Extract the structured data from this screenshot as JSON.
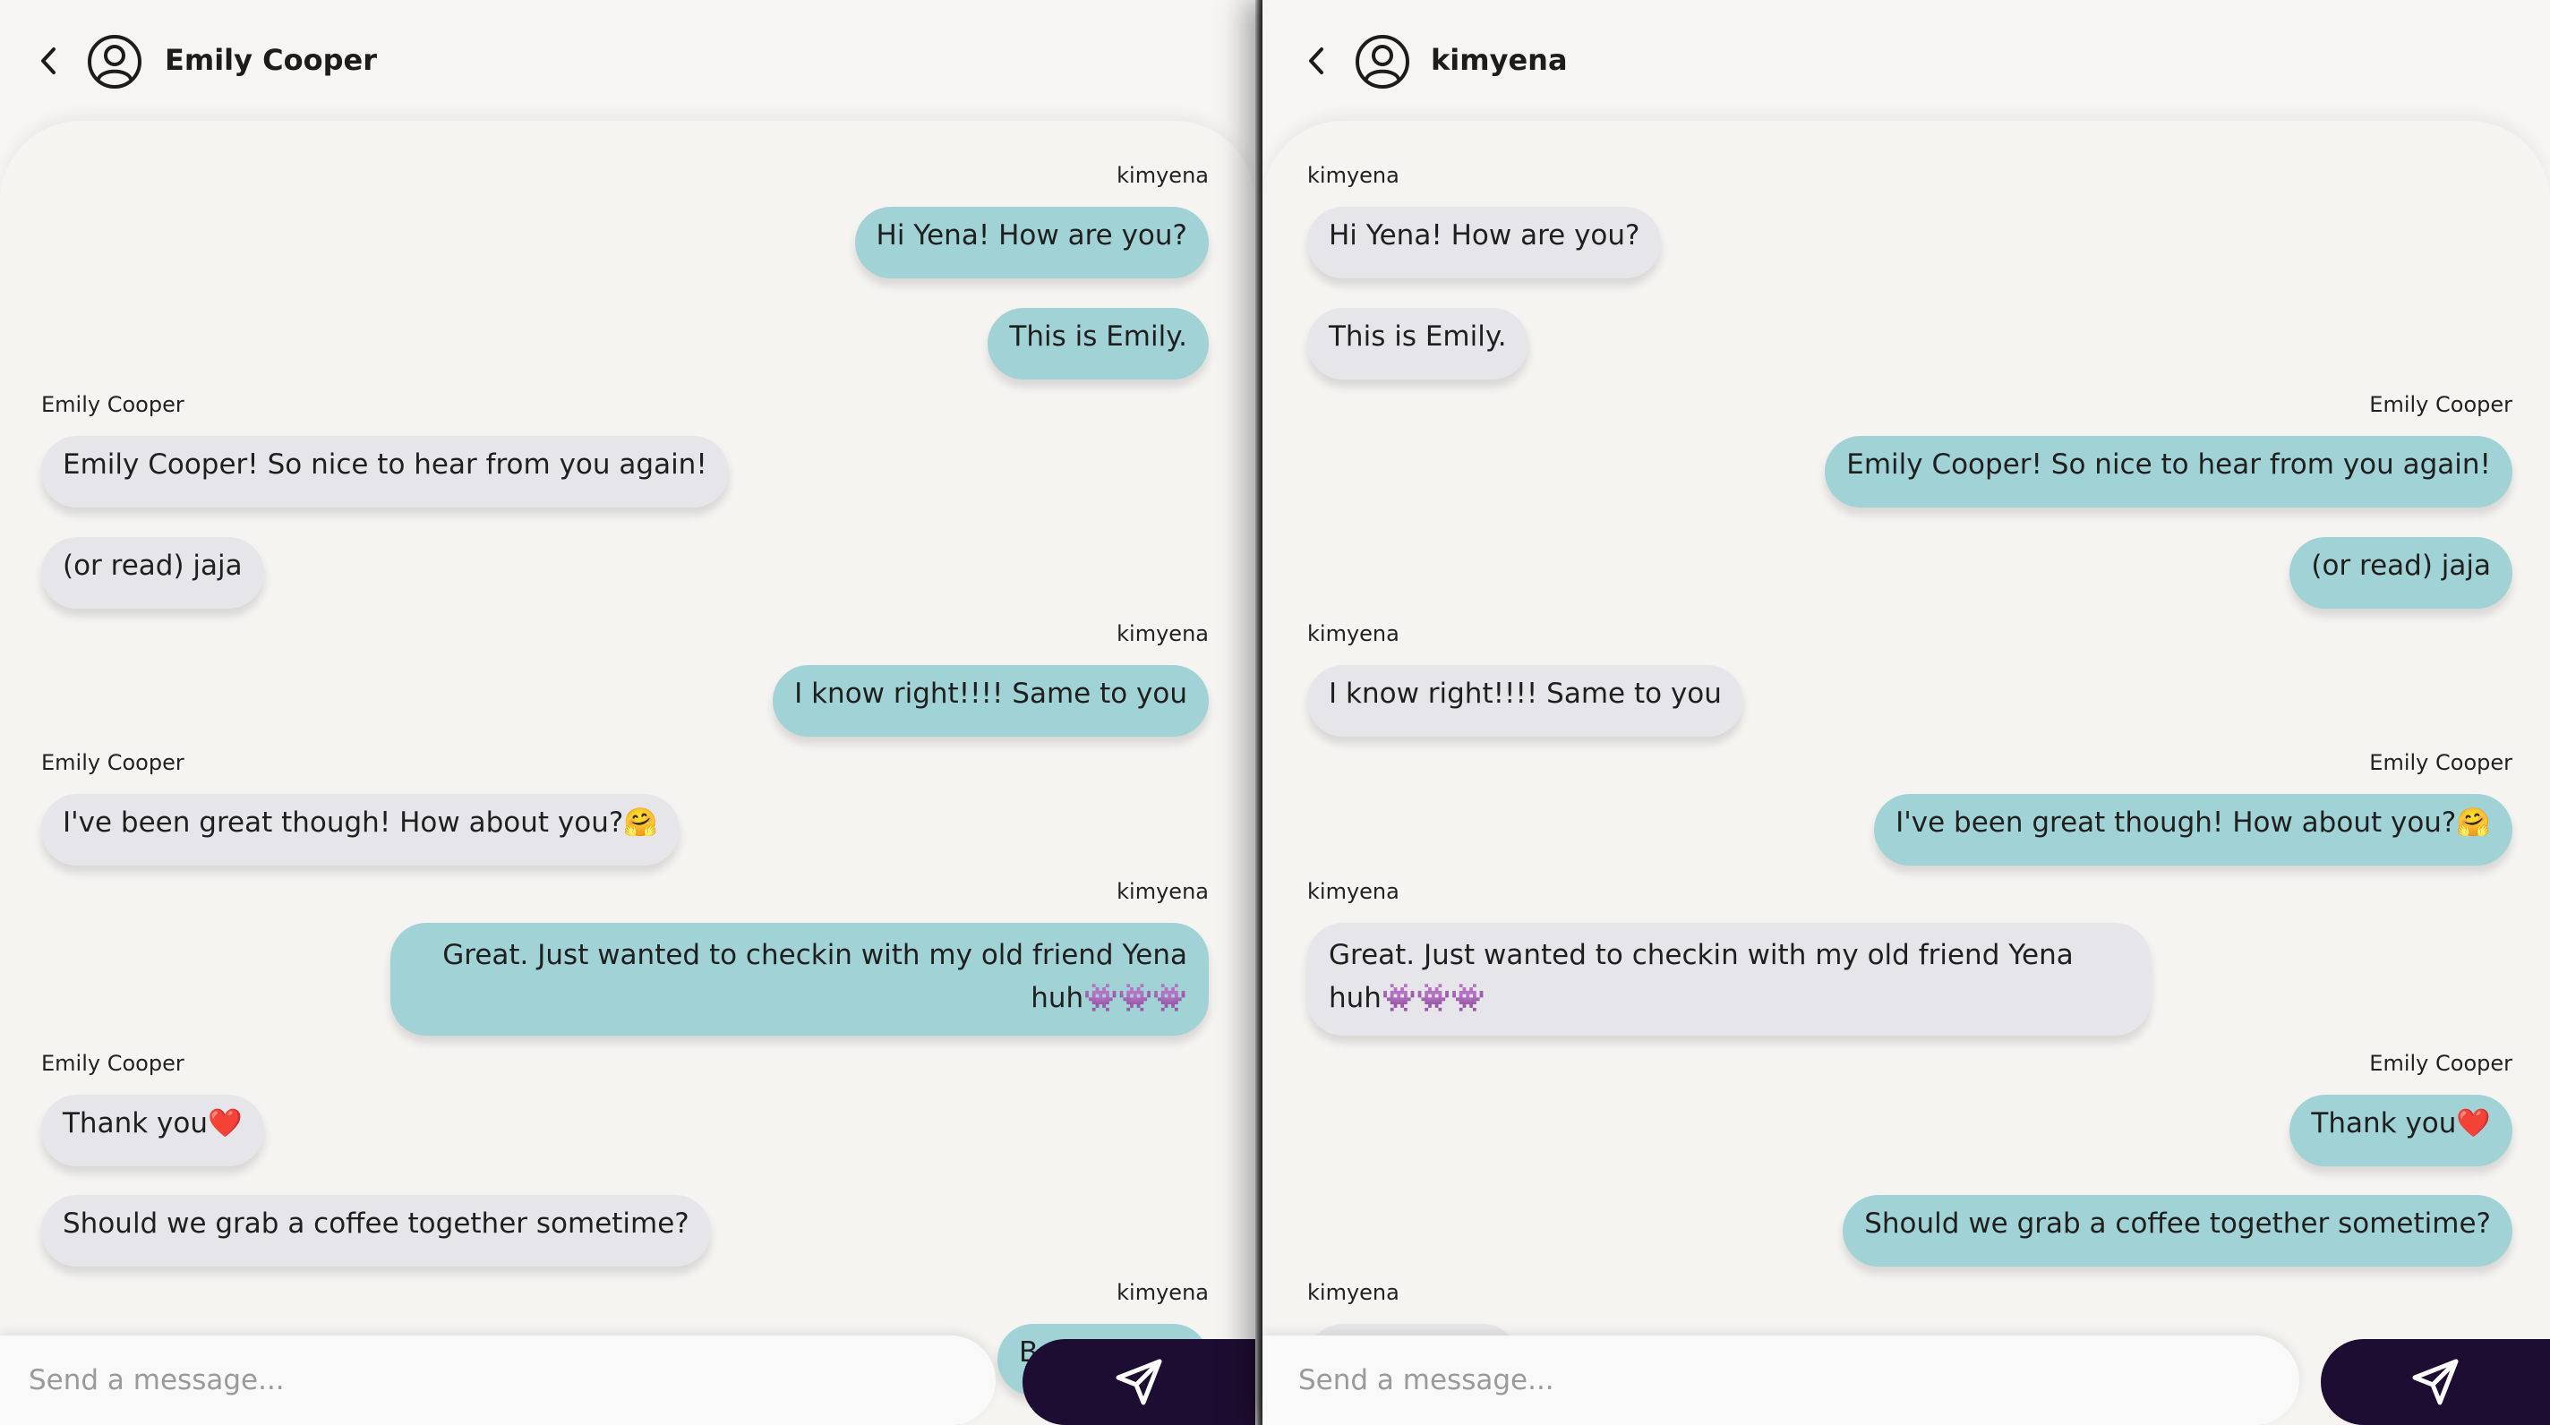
{
  "left": {
    "title": "Emily Cooper",
    "input_placeholder": "Send a message...",
    "partial_bubble_text": "B",
    "messages": [
      {
        "sender": "kimyena",
        "text": "Hi Yena! How are you?"
      },
      {
        "text": "This is Emily."
      },
      {
        "sender": "Emily Cooper",
        "text": "Emily Cooper! So nice to hear from you again!"
      },
      {
        "text": "(or read) jaja"
      },
      {
        "sender": "kimyena",
        "text": "I know right!!!! Same to you"
      },
      {
        "sender": "Emily Cooper",
        "text": "I've been great though! How about you?🤗"
      },
      {
        "sender": "kimyena",
        "text": "Great. Just wanted to checkin with my old friend Yena huh👾👾👾"
      },
      {
        "sender": "Emily Cooper",
        "text": "Thank you❤️"
      },
      {
        "text": "Should we grab a coffee together sometime?"
      },
      {
        "sender": "kimyena"
      }
    ]
  },
  "right": {
    "title": "kimyena",
    "input_placeholder": "Send a message...",
    "messages": [
      {
        "sender": "kimyena",
        "text": "Hi Yena! How are you?"
      },
      {
        "text": "This is Emily."
      },
      {
        "sender": "Emily Cooper",
        "text": "Emily Cooper! So nice to hear from you again!"
      },
      {
        "text": "(or read) jaja"
      },
      {
        "sender": "kimyena",
        "text": "I know right!!!! Same to you"
      },
      {
        "sender": "Emily Cooper",
        "text": "I've been great though! How about you?🤗"
      },
      {
        "sender": "kimyena",
        "text": "Great. Just wanted to checkin with my old friend Yena huh👾👾👾"
      },
      {
        "sender": "Emily Cooper",
        "text": "Thank you❤️"
      },
      {
        "text": "Should we grab a coffee together sometime?"
      },
      {
        "sender": "kimyena"
      }
    ]
  },
  "icons": {
    "back": "chevron-left-icon",
    "avatar": "user-circle-icon",
    "send": "send-paper-plane-icon"
  },
  "colors": {
    "outgoing_bubble": "#a1d2d6",
    "incoming_bubble": "#e6e6ea",
    "send_button": "#1e0d32",
    "background": "#f7f5f3"
  }
}
